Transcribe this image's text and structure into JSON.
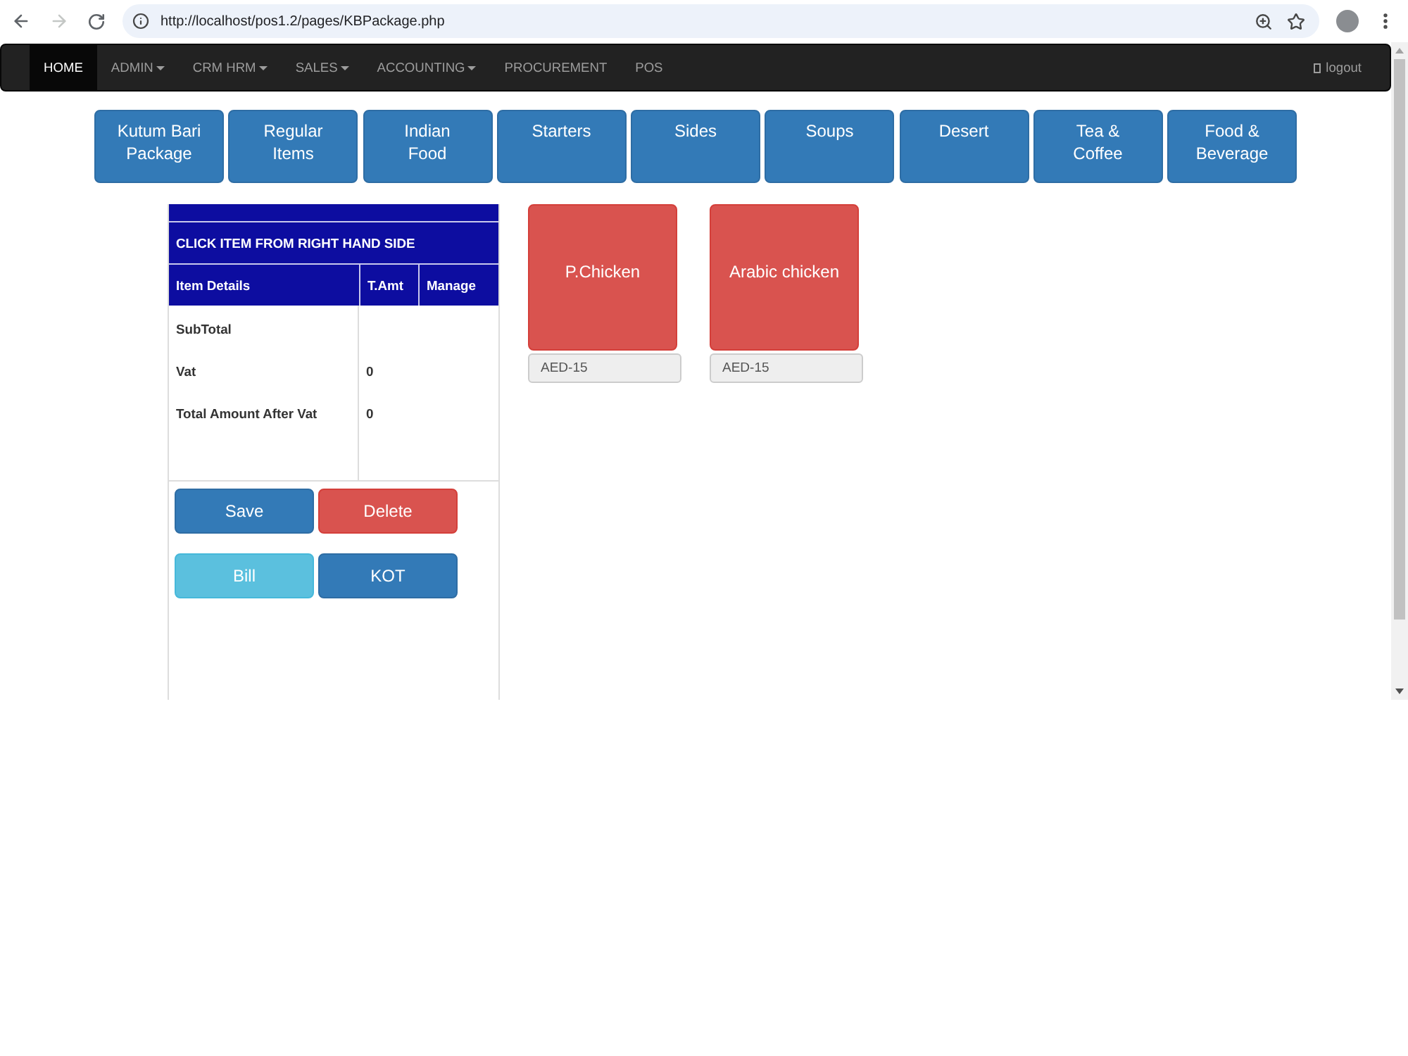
{
  "browser": {
    "url": "http://localhost/pos1.2/pages/KBPackage.php",
    "forward_disabled": true
  },
  "navbar": {
    "items": [
      {
        "label": "HOME",
        "selected": true,
        "dropdown": false
      },
      {
        "label": "ADMIN",
        "selected": false,
        "dropdown": true
      },
      {
        "label": "CRM HRM",
        "selected": false,
        "dropdown": true
      },
      {
        "label": "SALES",
        "selected": false,
        "dropdown": true
      },
      {
        "label": "ACCOUNTING",
        "selected": false,
        "dropdown": true
      },
      {
        "label": "PROCUREMENT",
        "selected": false,
        "dropdown": false
      },
      {
        "label": "POS",
        "selected": false,
        "dropdown": false
      }
    ],
    "logout": "logout"
  },
  "categories": [
    "Kutum Bari Package",
    "Regular Items",
    "Indian Food",
    "Starters",
    "Sides",
    "Soups",
    "Desert",
    "Tea & Coffee",
    "Food & Beverage"
  ],
  "order_panel": {
    "title": "CLICK ITEM FROM RIGHT HAND SIDE",
    "columns": [
      "Item Details",
      "T.Amt",
      "Manage"
    ],
    "summary_rows": [
      {
        "label": "SubTotal"
      },
      {
        "label": "Vat",
        "amount": "0"
      },
      {
        "label": "Total Amount After Vat",
        "amount": "0"
      }
    ],
    "buttons": [
      {
        "label": "Save",
        "kind": "primary"
      },
      {
        "label": "Delete",
        "kind": "danger"
      },
      {
        "label": "Bill",
        "kind": "info"
      },
      {
        "label": "KOT",
        "kind": "primary"
      }
    ]
  },
  "products": [
    {
      "name": "P.Chicken",
      "price": "AED-15"
    },
    {
      "name": "Arabic chicken",
      "price": "AED-15"
    }
  ]
}
